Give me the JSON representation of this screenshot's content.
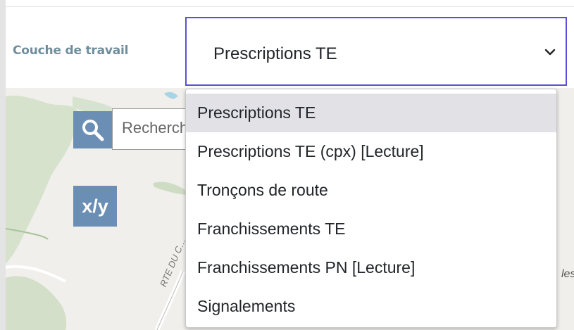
{
  "panel": {
    "label": "Couche de travail"
  },
  "select": {
    "value": "Prescriptions TE",
    "options": [
      "Prescriptions TE",
      "Prescriptions TE (cpx) [Lecture]",
      "Tronçons de route",
      "Franchissements TE",
      "Franchissements PN [Lecture]",
      "Signalements"
    ],
    "chevron_icon": "chevron-down-icon"
  },
  "map": {
    "search_placeholder": "Recherche",
    "search_icon": "search-icon",
    "xy_label": "x/y",
    "road_label": "RTE DU C…",
    "edge_label": "les"
  },
  "colors": {
    "accent_border": "#5b4fd6",
    "map_button": "#6b8eb4",
    "label": "#6f8d9d",
    "selected_option": "#e1e1e6"
  }
}
